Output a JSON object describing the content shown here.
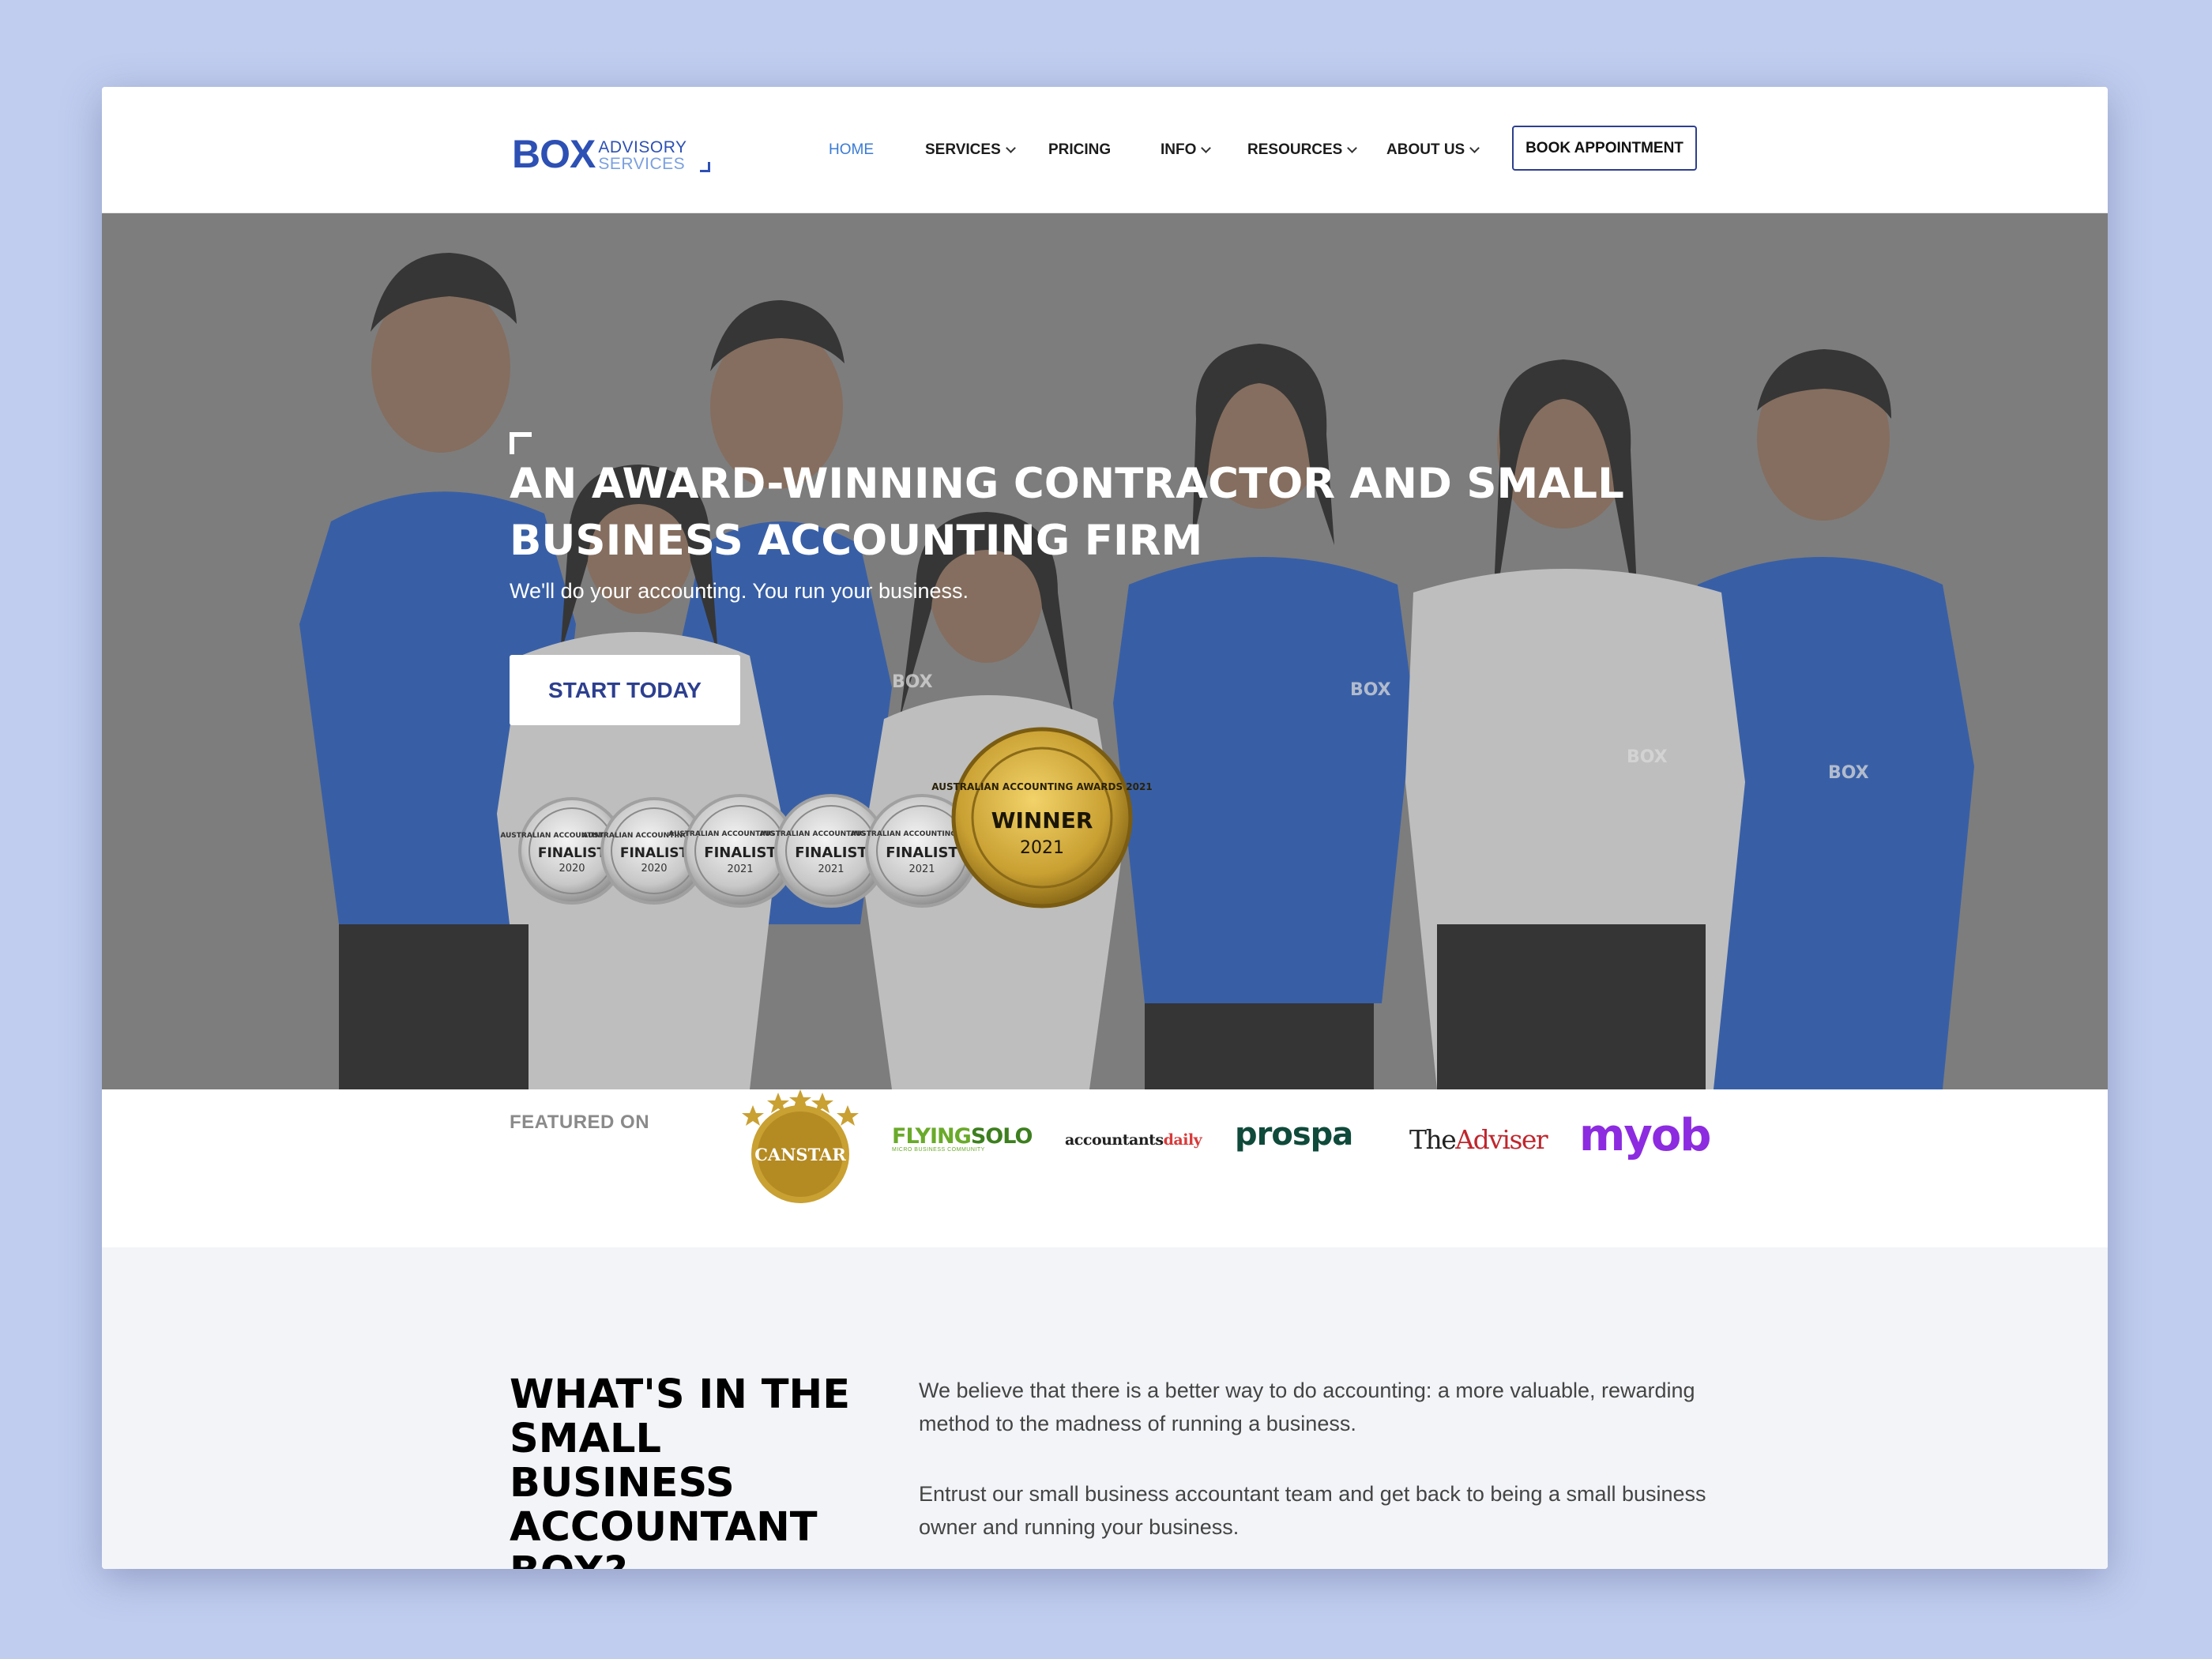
{
  "header": {
    "logo": {
      "main": "BOX",
      "line1": "ADVISORY",
      "line2": "SERVICES"
    },
    "nav": [
      {
        "label": "HOME",
        "active": true,
        "dropdown": false
      },
      {
        "label": "SERVICES",
        "active": false,
        "dropdown": true
      },
      {
        "label": "PRICING",
        "active": false,
        "dropdown": false
      },
      {
        "label": "INFO",
        "active": false,
        "dropdown": true
      },
      {
        "label": "RESOURCES",
        "active": false,
        "dropdown": true
      },
      {
        "label": "ABOUT US",
        "active": false,
        "dropdown": true
      }
    ],
    "book_label": "BOOK APPOINTMENT"
  },
  "hero": {
    "title": "AN AWARD-WINNING CONTRACTOR AND SMALL BUSINESS ACCOUNTING FIRM",
    "subtitle": "We'll do your accounting. You run your business.",
    "cta_label": "START TODAY",
    "awards": [
      {
        "kind": "finalist",
        "top": "AUSTRALIAN ACCOUNTING AWARDS",
        "label": "FINALIST",
        "year": "2020"
      },
      {
        "kind": "finalist",
        "top": "AUSTRALIAN ACCOUNTING AWARDS",
        "label": "FINALIST",
        "year": "2020"
      },
      {
        "kind": "finalist",
        "top": "AUSTRALIAN ACCOUNTING AWARDS",
        "label": "FINALIST",
        "year": "2021"
      },
      {
        "kind": "finalist",
        "top": "AUSTRALIAN ACCOUNTING AWARDS",
        "label": "FINALIST",
        "year": "2021"
      },
      {
        "kind": "finalist",
        "top": "AUSTRALIAN ACCOUNTING AWARDS",
        "label": "FINALIST",
        "year": "2021"
      },
      {
        "kind": "winner",
        "top": "AUSTRALIAN ACCOUNTING AWARDS 2021",
        "label": "WINNER",
        "year": "2021"
      }
    ],
    "shirt_logo": "BOX"
  },
  "featured": {
    "label": "FEATURED ON",
    "logos": {
      "canstar": "CANSTAR",
      "flyingsolo_a": "FLYING",
      "flyingsolo_b": "SOLO",
      "flyingsolo_sub": "MICRO BUSINESS COMMUNITY",
      "accountants_a": "accountants",
      "accountants_b": "daily",
      "prospa": "prospa",
      "adviser_a": "The",
      "adviser_b": "Adviser",
      "myob": "myob"
    }
  },
  "content": {
    "title": "WHAT'S IN THE SMALL BUSINESS ACCOUNTANT BOX?",
    "paragraphs": [
      "We believe that there is a better way to do accounting: a more valuable, rewarding method to the madness of running a business.",
      "Entrust our small business accountant team and get back to being a small business owner and running your business."
    ]
  },
  "colors": {
    "page_bg": "#c0cdef",
    "brand_blue": "#2d50b4",
    "nav_active": "#3a7bd5",
    "hero_overlay": "#808080",
    "shirt_blue": "#1f55b8",
    "shirt_white": "#dadada",
    "gold": "#c9a032",
    "section_bg": "#f2f4f7"
  }
}
